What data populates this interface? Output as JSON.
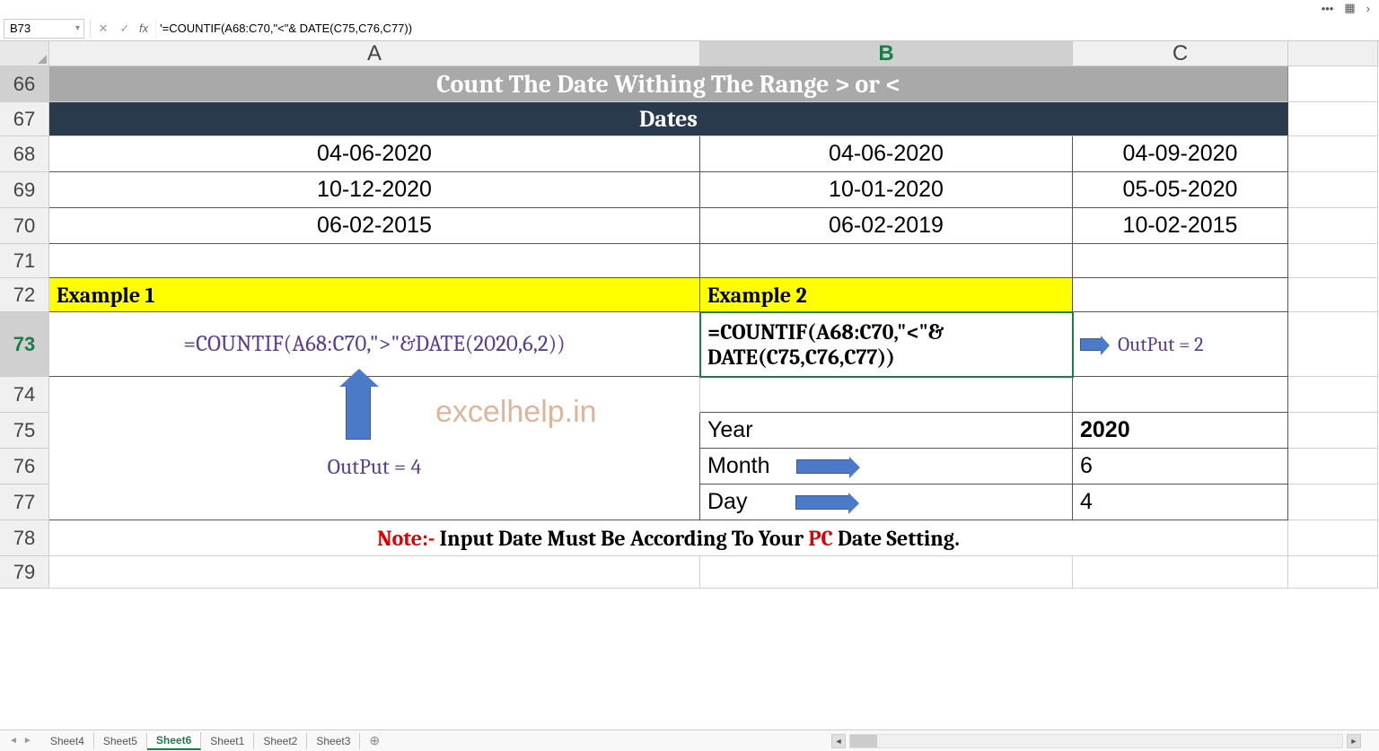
{
  "top": {
    "dots": "•••",
    "grid_icon": "▦",
    "more": "›"
  },
  "fb": {
    "name": "B73",
    "cancel": "✕",
    "confirm": "✓",
    "fx": "fx",
    "formula": "'=COUNTIF(A68:C70,\"<\"& DATE(C75,C76,C77))"
  },
  "cols": {
    "a": "A",
    "b": "B",
    "c": "C"
  },
  "rowh": {
    "66": "66",
    "67": "67",
    "68": "68",
    "69": "69",
    "70": "70",
    "71": "71",
    "72": "72",
    "73": "73",
    "74": "74",
    "75": "75",
    "76": "76",
    "77": "77",
    "78": "78",
    "79": "79"
  },
  "r66": {
    "title": "Count The Date Withing The Range > or <"
  },
  "r67": {
    "title": "Dates"
  },
  "r68": {
    "a": "04-06-2020",
    "b": "04-06-2020",
    "c": "04-09-2020"
  },
  "r69": {
    "a": "10-12-2020",
    "b": "10-01-2020",
    "c": "05-05-2020"
  },
  "r70": {
    "a": "06-02-2015",
    "b": "06-02-2019",
    "c": "10-02-2015"
  },
  "r72": {
    "a": "Example 1",
    "b": "Example 2"
  },
  "r73": {
    "a": "=COUNTIF(A68:C70,\">\"&DATE(2020,6,2))",
    "b": "=COUNTIF(A68:C70,\"<\"& DATE(C75,C76,C77))",
    "c": "OutPut  =  2"
  },
  "r75": {
    "b": "Year",
    "c": "2020"
  },
  "r76": {
    "a": "OutPut  =  4",
    "b": "Month",
    "c": "6"
  },
  "r77": {
    "b": "Day",
    "c": "4"
  },
  "r78": {
    "note_lbl": "Note:-",
    "note_txt": " Input Date Must Be According To Your ",
    "note_pc": "PC",
    "note_end": " Date Setting."
  },
  "watermark": "excelhelp.in",
  "tabs": {
    "nav_l": "◄",
    "nav_r": "►",
    "t1": "Sheet4",
    "t2": "Sheet5",
    "t3": "Sheet6",
    "t4": "Sheet1",
    "t5": "Sheet2",
    "t6": "Sheet3",
    "add": "⊕"
  },
  "col_hdr_active": "B"
}
